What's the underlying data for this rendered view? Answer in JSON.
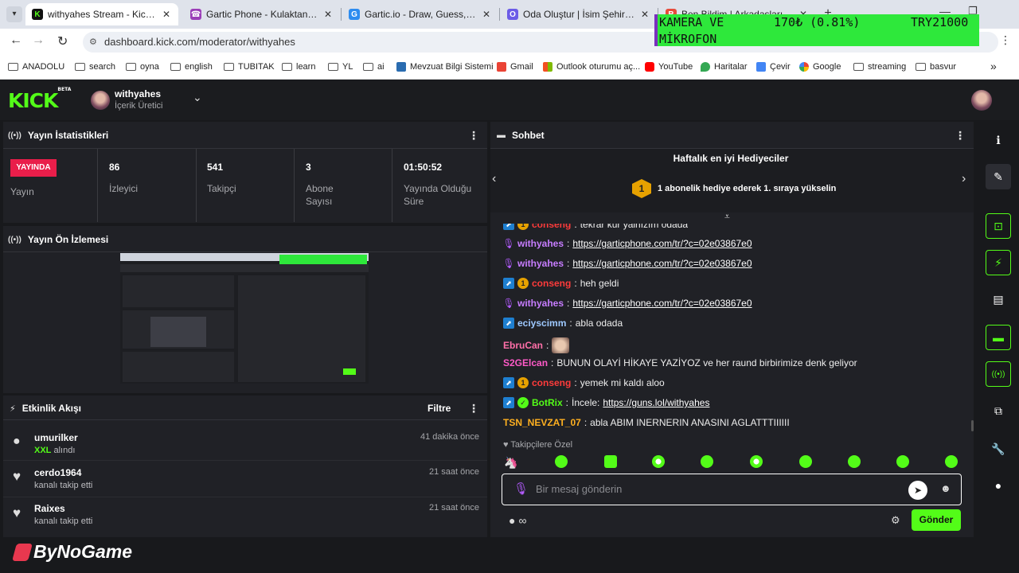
{
  "browser": {
    "tabs": [
      {
        "title": "withyahes Stream - Kick Dashbo",
        "active": true,
        "icon": "kick-icon"
      },
      {
        "title": "Gartic Phone - Kulaktan Kulağa",
        "active": false,
        "icon": "gartic-phone-icon"
      },
      {
        "title": "Gartic.io - Draw, Guess, WIN",
        "active": false,
        "icon": "gartic-io-icon"
      },
      {
        "title": "Oda Oluştur | İsim Şehir Katmar",
        "active": false,
        "icon": "oda-icon"
      },
      {
        "title": "Ben Bildim | Arkadaşlarınla Onl",
        "active": false,
        "icon": "ben-bildim-icon"
      }
    ],
    "new_tab": "+",
    "url": "dashboard.kick.com/moderator/withyahes",
    "bookmarks": [
      "ANADOLU",
      "search",
      "oyna",
      "english",
      "TUBITAK",
      "learn",
      "YL",
      "ai",
      "Mevzuat Bilgi Sistemi",
      "Gmail",
      "Outlook oturumu aç...",
      "YouTube",
      "Haritalar",
      "Çevir",
      "Google",
      "streaming",
      "basvur"
    ],
    "bookmarks_more": "»"
  },
  "overlay": {
    "line1": "KAMERA VE",
    "line2": "MİKROFON",
    "value": "170₺ (0.81%)",
    "total": "TRY21000"
  },
  "kick": {
    "logo": "KICK",
    "logo_badge": "BETA",
    "channel_name": "withyahes",
    "channel_role": "İçerik Üretici"
  },
  "stats": {
    "title": "Yayın İstatistikleri",
    "live_badge": "YAYINDA",
    "live_label": "Yayın",
    "items": [
      {
        "value": "86",
        "label": "İzleyici"
      },
      {
        "value": "541",
        "label": "Takipçi"
      },
      {
        "value": "3",
        "label": "Abone Sayısı"
      },
      {
        "value": "01:50:52",
        "label": "Yayında Olduğu Süre"
      }
    ]
  },
  "preview": {
    "title": "Yayın Ön İzlemesi"
  },
  "activity": {
    "title": "Etkinlik Akışı",
    "filter": "Filtre",
    "events": [
      {
        "name": "umurilker",
        "detail_highlight": "XXL",
        "detail": "alındı",
        "time": "41 dakika önce",
        "icon": "kicks-icon"
      },
      {
        "name": "cerdo1964",
        "detail_highlight": "",
        "detail": "kanalı takip etti",
        "time": "21 saat önce",
        "icon": "heart-icon"
      },
      {
        "name": "Raixes",
        "detail_highlight": "",
        "detail": "kanalı takip etti",
        "time": "21 saat önce",
        "icon": "heart-icon"
      }
    ]
  },
  "chat": {
    "title": "Sohbet",
    "gifters_title": "Haftalık en iyi Hediyeciler",
    "gifters_rank": "1",
    "gifters_text": "1 abonelik hediye ederek 1. sıraya yükselin",
    "messages": [
      {
        "badges": [
          "b",
          "g"
        ],
        "user": "conseng",
        "color": "#ff3b3b",
        "text": "tekrar kur yalnızım odada",
        "link": ""
      },
      {
        "badges": [
          "m"
        ],
        "user": "withyahes",
        "color": "#c77dff",
        "text": "",
        "link": "https://garticphone.com/tr/?c=02e03867e0"
      },
      {
        "badges": [
          "m"
        ],
        "user": "withyahes",
        "color": "#c77dff",
        "text": "",
        "link": "https://garticphone.com/tr/?c=02e03867e0"
      },
      {
        "badges": [
          "b",
          "g"
        ],
        "user": "conseng",
        "color": "#ff3b3b",
        "text": "heh geldi",
        "link": ""
      },
      {
        "badges": [
          "m"
        ],
        "user": "withyahes",
        "color": "#c77dff",
        "text": "",
        "link": "https://garticphone.com/tr/?c=02e03867e0"
      },
      {
        "badges": [
          "b"
        ],
        "user": "eciyscimm",
        "color": "#9ec9ff",
        "text": "abla odada",
        "link": ""
      },
      {
        "badges": [],
        "user": "EbruCan",
        "color": "#ff6fa8",
        "text": "",
        "link": ""
      },
      {
        "badges": [],
        "user": "S2GElcan",
        "color": "#ff5ac8",
        "text": "BUNUN OLAYİ HİKAYE YAZİYOZ ve her raund birbirimize denk geliyor",
        "link": ""
      },
      {
        "badges": [
          "b",
          "g"
        ],
        "user": "conseng",
        "color": "#ff3b3b",
        "text": "yemek mi kaldı aloo",
        "link": ""
      },
      {
        "badges": [
          "b",
          "v"
        ],
        "user": "BotRix",
        "color": "#53fc18",
        "text": "İncele:",
        "link": "https://guns.lol/withyahes"
      },
      {
        "badges": [],
        "user": "TSN_NEVZAT_07",
        "color": "#ffb020",
        "text": "abla ABIM INERNERIN ANASINI AGLATTTIIIIII",
        "link": ""
      }
    ],
    "followers_only": "Takipçilere Özel",
    "input_placeholder": "Bir mesaj gönderin",
    "kicks_amount": "∞",
    "send_label": "Gönder"
  },
  "watermark": "ByNoGame",
  "colors": {
    "accent": "#53fc18",
    "live": "#e91e4a",
    "bg": "#18191c",
    "panel": "#202126"
  }
}
